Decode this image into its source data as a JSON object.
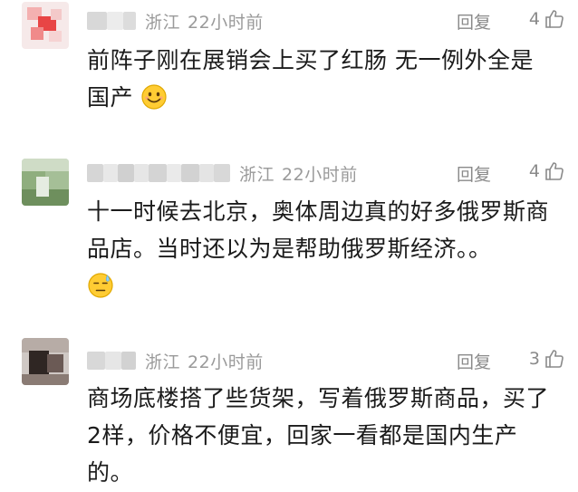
{
  "comments": [
    {
      "location": "浙江",
      "time": "22小时前",
      "reply_label": "回复",
      "likes": "4",
      "text": "前阵子刚在展销会上买了红肠  无一例外全是国产",
      "emoji": "grinning-face-emoji",
      "avatar_color": "#e84545"
    },
    {
      "location": "浙江",
      "time": "22小时前",
      "reply_label": "回复",
      "likes": "4",
      "text": "十一时候去北京，奥体周边真的好多俄罗斯商品店。当时还以为是帮助俄罗斯经济。。",
      "emoji": "downcast-face-with-sweat-emoji",
      "avatar_color": "#8fae7e"
    },
    {
      "location": "浙江",
      "time": "22小时前",
      "reply_label": "回复",
      "likes": "3",
      "text": "商场底楼搭了些货架，写着俄罗斯商品，买了2样，价格不便宜，回家一看都是国内生产的。",
      "avatar_color": "#6b5a55"
    }
  ],
  "colors": {
    "meta_text": "#9a9a9a",
    "body_text": "#1b1b1b",
    "emoji_yellow": "#ffcc33"
  }
}
